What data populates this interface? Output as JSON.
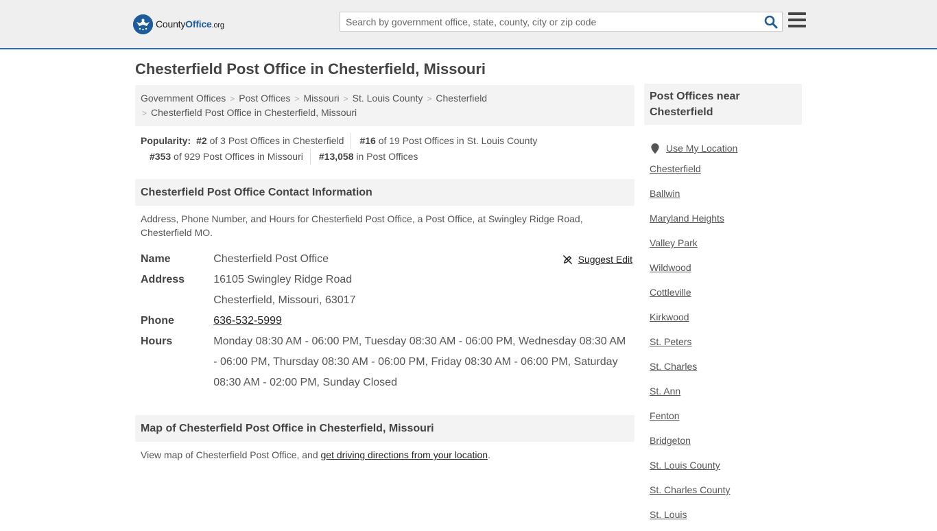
{
  "header": {
    "logo": {
      "brand_county": "County",
      "brand_office": "Office",
      "brand_tld": ".org"
    },
    "search_placeholder": "Search by government office, state, county, city or zip code"
  },
  "page_title": "Chesterfield Post Office in Chesterfield, Missouri",
  "breadcrumb": {
    "items": [
      "Government Offices",
      "Post Offices",
      "Missouri",
      "St. Louis County",
      "Chesterfield"
    ],
    "current": "Chesterfield Post Office in Chesterfield, Missouri"
  },
  "popularity": {
    "label": "Popularity:",
    "items": [
      {
        "rank": "#2",
        "text": "of 3 Post Offices in Chesterfield"
      },
      {
        "rank": "#16",
        "text": "of 19 Post Offices in St. Louis County"
      },
      {
        "rank": "#353",
        "text": "of 929 Post Offices in Missouri"
      },
      {
        "rank": "#13,058",
        "text": "in Post Offices"
      }
    ]
  },
  "contact": {
    "heading": "Chesterfield Post Office Contact Information",
    "description": "Address, Phone Number, and Hours for Chesterfield Post Office, a Post Office, at Swingley Ridge Road, Chesterfield MO.",
    "suggest_edit": "Suggest Edit",
    "fields": {
      "name_label": "Name",
      "name_value": "Chesterfield Post Office",
      "address_label": "Address",
      "address_line1": "16105 Swingley Ridge Road",
      "address_line2": "Chesterfield, Missouri, 63017",
      "phone_label": "Phone",
      "phone_value": "636-532-5999",
      "hours_label": "Hours",
      "hours_value": "Monday 08:30 AM - 06:00 PM, Tuesday 08:30 AM - 06:00 PM, Wednesday 08:30 AM - 06:00 PM, Thursday 08:30 AM - 06:00 PM, Friday 08:30 AM - 06:00 PM, Saturday 08:30 AM - 02:00 PM, Sunday Closed"
    }
  },
  "map": {
    "heading": "Map of Chesterfield Post Office in Chesterfield, Missouri",
    "text_before": "View map of Chesterfield Post Office, and ",
    "link": "get driving directions from your location",
    "text_after": "."
  },
  "sidebar": {
    "heading": "Post Offices near Chesterfield",
    "use_location": "Use My Location",
    "links": [
      "Chesterfield",
      "Ballwin",
      "Maryland Heights",
      "Valley Park",
      "Wildwood",
      "Cottleville",
      "Kirkwood",
      "St. Peters",
      "St. Charles",
      "St. Ann",
      "Fenton",
      "Bridgeton",
      "St. Louis County",
      "St. Charles County",
      "St. Louis"
    ]
  },
  "colors": {
    "accent": "#2a6eb0",
    "logo_blue": "#1d5c9b",
    "panel_bg": "#f3f3f3",
    "header_bg": "#efefef"
  }
}
